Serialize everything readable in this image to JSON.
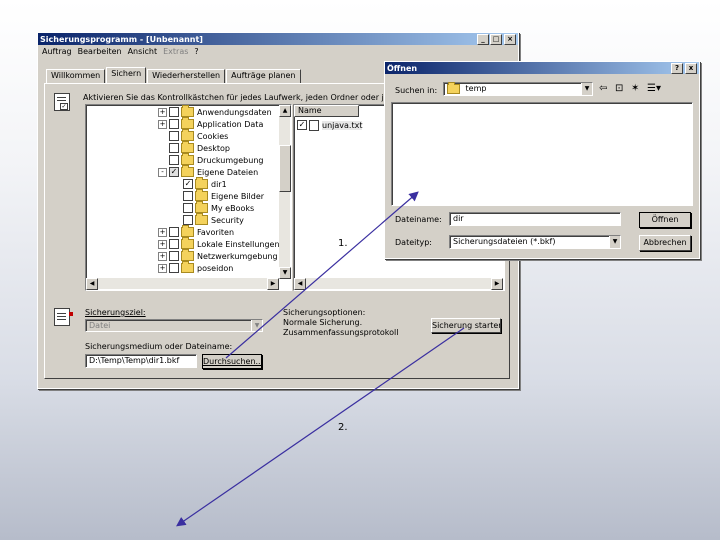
{
  "main_window": {
    "title": "Sicherungsprogramm - [Unbenannt]",
    "menu": [
      "Auftrag",
      "Bearbeiten",
      "Ansicht",
      "Extras",
      "?"
    ],
    "tabs": [
      "Willkommen",
      "Sichern",
      "Wiederherstellen",
      "Aufträge planen"
    ],
    "active_tab": "Sichern",
    "instruction": "Aktivieren Sie das Kontrollkästchen für jedes Laufwerk, jeden Ordner oder jede Datei",
    "tree_items": [
      {
        "label": "Anwendungsdaten",
        "expander": "+",
        "checked": false
      },
      {
        "label": "Application Data",
        "expander": "+",
        "checked": false
      },
      {
        "label": "Cookies",
        "expander": "",
        "checked": false
      },
      {
        "label": "Desktop",
        "expander": "",
        "checked": false
      },
      {
        "label": "Druckumgebung",
        "expander": "",
        "checked": false
      },
      {
        "label": "Eigene Dateien",
        "expander": "-",
        "checked": "partial"
      },
      {
        "label": "dir1",
        "expander": "",
        "checked": true
      },
      {
        "label": "Eigene Bilder",
        "expander": "",
        "checked": false
      },
      {
        "label": "My eBooks",
        "expander": "",
        "checked": false
      },
      {
        "label": "Security",
        "expander": "",
        "checked": false
      },
      {
        "label": "Favoriten",
        "expander": "+",
        "checked": false
      },
      {
        "label": "Lokale Einstellungen",
        "expander": "+",
        "checked": false
      },
      {
        "label": "Netzwerkumgebung",
        "expander": "+",
        "checked": false
      },
      {
        "label": "poseidon",
        "expander": "+",
        "checked": false
      }
    ],
    "list_header": "Name",
    "list_items": [
      {
        "label": "unjava.txt",
        "checked": true
      }
    ],
    "target_label": "Sicherungsziel:",
    "target_value": "Datei",
    "options_label": "Sicherungsoptionen:",
    "options_lines": [
      "Normale Sicherung.",
      "Zusammenfassungsprotokoll"
    ],
    "media_label": "Sicherungsmedium oder Dateiname:",
    "media_value": "D:\\Temp\\Temp\\dir1.bkf",
    "browse_button": "Durchsuchen...",
    "start_button": "Sicherung starten"
  },
  "open_dialog": {
    "title": "Öffnen",
    "title_buttons": [
      "?",
      "x"
    ],
    "lookin_label": "Suchen in:",
    "lookin_value": "temp",
    "filename_label": "Dateiname:",
    "filename_value": "dir",
    "filetype_label": "Dateityp:",
    "filetype_value": "Sicherungsdateien (*.bkf)",
    "open_button": "Öffnen",
    "cancel_button": "Abbrechen"
  },
  "annotations": {
    "step1": "1.",
    "step2": "2."
  },
  "colors": {
    "titlebar_start": "#0a246a",
    "titlebar_end": "#a6caf0",
    "window_face": "#d4d0c8",
    "arrow_color": "#3a2fa0"
  }
}
